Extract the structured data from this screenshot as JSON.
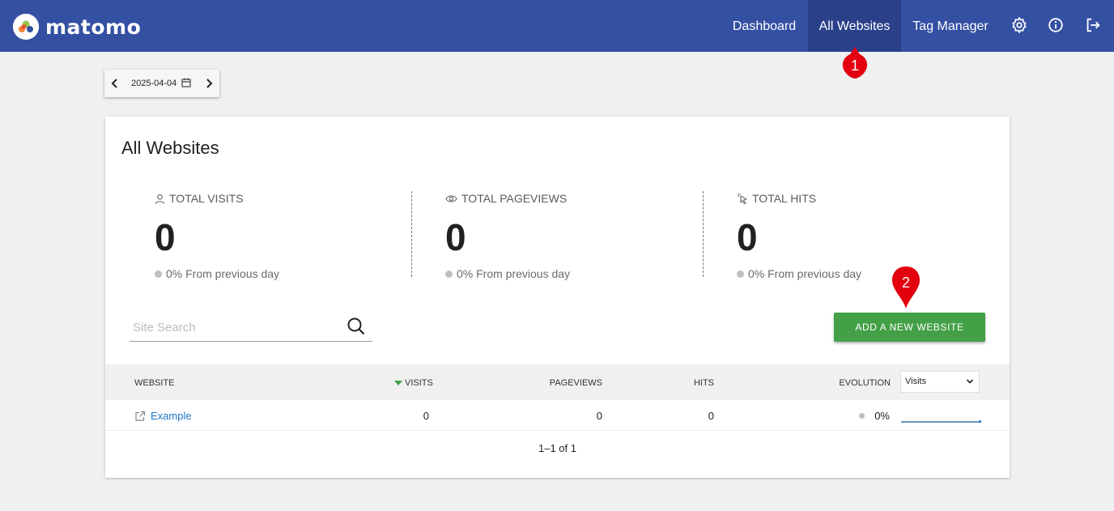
{
  "brand": {
    "name": "matomo"
  },
  "nav": {
    "dashboard": "Dashboard",
    "all_websites": "All Websites",
    "tag_manager": "Tag Manager"
  },
  "date": {
    "value": "2025-04-04"
  },
  "card": {
    "title": "All Websites",
    "kpis": [
      {
        "label": "TOTAL VISITS",
        "value": "0",
        "change": "0% From previous day",
        "icon": "user-icon"
      },
      {
        "label": "TOTAL PAGEVIEWS",
        "value": "0",
        "change": "0% From previous day",
        "icon": "eye-icon"
      },
      {
        "label": "TOTAL HITS",
        "value": "0",
        "change": "0% From previous day",
        "icon": "cursor-click-icon"
      }
    ],
    "search": {
      "placeholder": "Site Search",
      "value": ""
    },
    "add_button": "ADD A NEW WEBSITE"
  },
  "table": {
    "headers": {
      "website": "WEBSITE",
      "visits": "VISITS",
      "pageviews": "PAGEVIEWS",
      "hits": "HITS",
      "evolution": "EVOLUTION"
    },
    "evolution_metric": "Visits",
    "rows": [
      {
        "website": "Example",
        "visits": "0",
        "pageviews": "0",
        "hits": "0",
        "evolution": "0%"
      }
    ],
    "pagination": "1–1 of 1"
  },
  "markers": [
    "1",
    "2"
  ],
  "colors": {
    "topbar": "#3450a3",
    "active_nav": "#2a418a",
    "button": "#43a047",
    "marker": "#e3000f",
    "link": "#1b74c5"
  }
}
